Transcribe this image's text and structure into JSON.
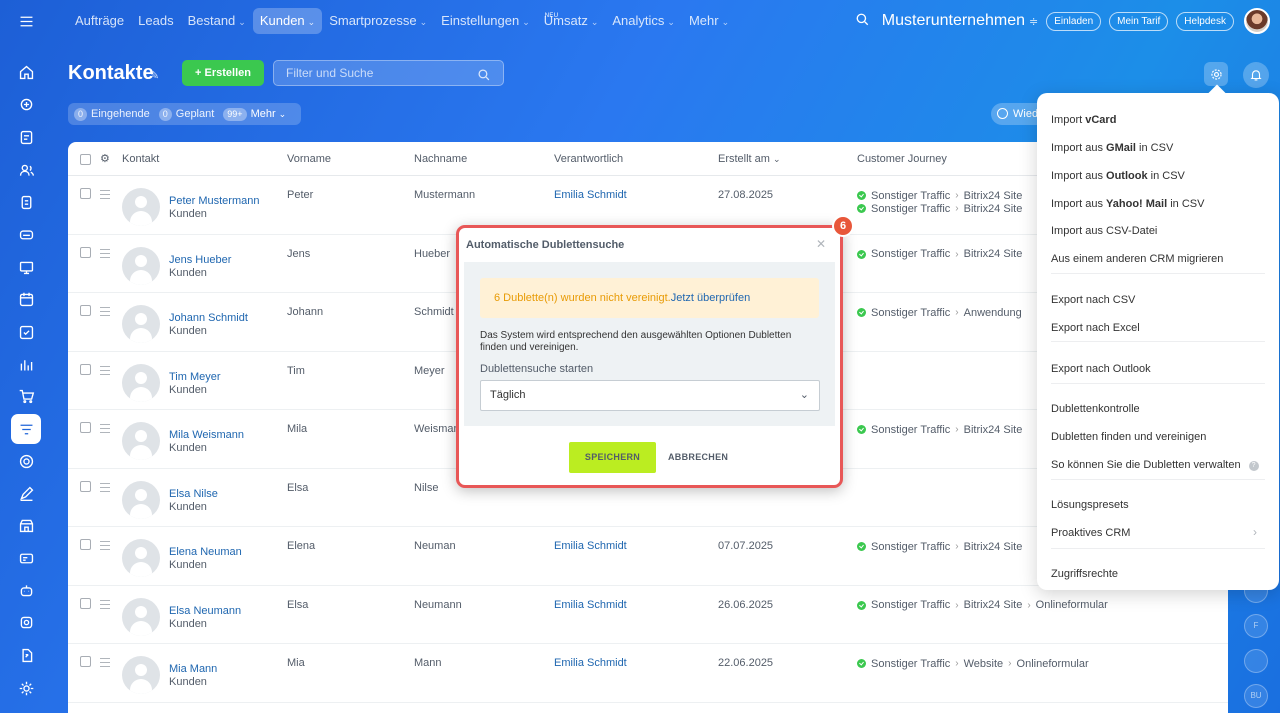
{
  "nav": {
    "items": [
      {
        "label": "Aufträge",
        "chevron": false
      },
      {
        "label": "Leads",
        "chevron": false
      },
      {
        "label": "Bestand",
        "chevron": true
      },
      {
        "label": "Kunden",
        "chevron": true,
        "active": true
      },
      {
        "label": "Smartprozesse",
        "chevron": true
      },
      {
        "label": "Einstellungen",
        "chevron": true
      },
      {
        "label": "Umsatz",
        "chevron": true,
        "badge": "NEU"
      },
      {
        "label": "Analytics",
        "chevron": true
      },
      {
        "label": "Mehr",
        "chevron": true
      }
    ],
    "company": "Musterunternehmen",
    "invite": "Einladen",
    "tariff": "Mein Tarif",
    "helpdesk": "Helpdesk"
  },
  "header": {
    "title": "Kontakte",
    "create": "Erstellen",
    "filter_placeholder": "Filter und Suche",
    "counters": [
      {
        "num": "0",
        "label": "Eingehende"
      },
      {
        "num": "0",
        "label": "Geplant"
      },
      {
        "num": "99+",
        "label": "Mehr"
      }
    ],
    "wied": "Wied"
  },
  "table": {
    "columns": {
      "kontakt": "Kontakt",
      "vorname": "Vorname",
      "nachname": "Nachname",
      "verantwortlich": "Verantwortlich",
      "erstellt": "Erstellt am",
      "journey": "Customer Journey"
    },
    "rows": [
      {
        "name": "Peter Mustermann",
        "sub": "Kunden",
        "vorname": "Peter",
        "nachname": "Mustermann",
        "resp": "Emilia Schmidt",
        "date": "27.08.2025",
        "journey": [
          [
            "Sonstiger Traffic",
            "Bitrix24 Site"
          ],
          [
            "Sonstiger Traffic",
            "Bitrix24 Site"
          ]
        ]
      },
      {
        "name": "Jens Hueber",
        "sub": "Kunden",
        "vorname": "Jens",
        "nachname": "Hueber",
        "resp": "",
        "date": "",
        "journey": [
          [
            "Sonstiger Traffic",
            "Bitrix24 Site"
          ]
        ]
      },
      {
        "name": "Johann Schmidt",
        "sub": "Kunden",
        "vorname": "Johann",
        "nachname": "Schmidt",
        "resp": "",
        "date": "",
        "journey": [
          [
            "Sonstiger Traffic",
            "Anwendung"
          ]
        ]
      },
      {
        "name": "Tim Meyer",
        "sub": "Kunden",
        "vorname": "Tim",
        "nachname": "Meyer",
        "resp": "",
        "date": "",
        "journey": []
      },
      {
        "name": "Mila Weismann",
        "sub": "Kunden",
        "vorname": "Mila",
        "nachname": "Weisman",
        "resp": "",
        "date": "",
        "journey": [
          [
            "Sonstiger Traffic",
            "Bitrix24 Site"
          ]
        ]
      },
      {
        "name": "Elsa Nilse",
        "sub": "Kunden",
        "vorname": "Elsa",
        "nachname": "Nilse",
        "resp": "",
        "date": "",
        "journey": []
      },
      {
        "name": "Elena Neuman",
        "sub": "Kunden",
        "vorname": "Elena",
        "nachname": "Neuman",
        "resp": "Emilia Schmidt",
        "date": "07.07.2025",
        "journey": [
          [
            "Sonstiger Traffic",
            "Bitrix24 Site"
          ]
        ]
      },
      {
        "name": "Elsa Neumann",
        "sub": "Kunden",
        "vorname": "Elsa",
        "nachname": "Neumann",
        "resp": "Emilia Schmidt",
        "date": "26.06.2025",
        "journey": [
          [
            "Sonstiger Traffic",
            "Bitrix24 Site",
            "Onlineformular"
          ]
        ]
      },
      {
        "name": "Mia Mann",
        "sub": "Kunden",
        "vorname": "Mia",
        "nachname": "Mann",
        "resp": "Emilia Schmidt",
        "date": "22.06.2025",
        "journey": [
          [
            "Sonstiger Traffic",
            "Website",
            "Onlineformular"
          ]
        ]
      }
    ]
  },
  "menu": {
    "items": [
      {
        "pre": "Import ",
        "bold": "vCard",
        "post": ""
      },
      {
        "pre": "Import aus ",
        "bold": "GMail",
        "post": " in CSV"
      },
      {
        "pre": "Import aus ",
        "bold": "Outlook",
        "post": " in CSV"
      },
      {
        "pre": "Import aus ",
        "bold": "Yahoo! Mail",
        "post": " in CSV"
      },
      {
        "pre": "Import aus CSV-Datei",
        "bold": "",
        "post": ""
      },
      {
        "pre": "Aus einem anderen CRM migrieren",
        "bold": "",
        "post": ""
      },
      {
        "pre": "Export nach CSV",
        "bold": "",
        "post": ""
      },
      {
        "pre": "Export nach Excel",
        "bold": "",
        "post": ""
      },
      {
        "pre": "Export nach Outlook",
        "bold": "",
        "post": ""
      },
      {
        "pre": "Dublettenkontrolle",
        "bold": "",
        "post": ""
      },
      {
        "pre": "Dubletten finden und vereinigen",
        "bold": "",
        "post": ""
      },
      {
        "pre": "So können Sie die Dubletten verwalten",
        "bold": "",
        "post": "",
        "help": true
      },
      {
        "pre": "Lösungspresets",
        "bold": "",
        "post": ""
      },
      {
        "pre": "Proaktives CRM",
        "bold": "",
        "post": "",
        "arrow": true
      },
      {
        "pre": "Zugriffsrechte",
        "bold": "",
        "post": ""
      }
    ]
  },
  "modal": {
    "title": "Automatische Dublettensuche",
    "warning": "6 Dublette(n) wurden nicht vereinigt.",
    "warning_link": "Jetzt überprüfen",
    "description": "Das System wird entsprechend den ausgewählten Optionen Dubletten finden und vereinigen.",
    "label": "Dublettensuche starten",
    "selected": "Täglich",
    "save": "SPEICHERN",
    "cancel": "ABBRECHEN",
    "step": "6"
  },
  "side_avatars": [
    "F",
    "BU"
  ]
}
